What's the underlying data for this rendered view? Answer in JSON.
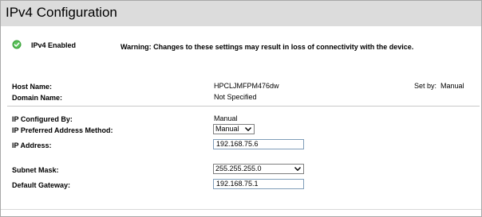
{
  "page": {
    "title": "IPv4 Configuration"
  },
  "status": {
    "label": "IPv4 Enabled",
    "warning": "Warning: Changes to these settings may result in loss of connectivity with the device.",
    "icon": "check-circle-icon",
    "icon_color": "#3aa33a"
  },
  "host": {
    "host_name_label": "Host Name:",
    "host_name_value": "HPCLJMFPM476dw",
    "set_by_label": "Set by:",
    "set_by_value": "Manual",
    "domain_name_label": "Domain Name:",
    "domain_name_value": "Not Specified"
  },
  "ip": {
    "configured_by_label": "IP Configured By:",
    "configured_by_value": "Manual",
    "preferred_method_label": "IP Preferred Address Method:",
    "preferred_method_value": "Manual",
    "address_label": "IP Address:",
    "address_value": "192.168.75.6",
    "subnet_label": "Subnet Mask:",
    "subnet_value": "255.255.255.0",
    "gateway_label": "Default Gateway:",
    "gateway_value": "192.168.75.1"
  }
}
